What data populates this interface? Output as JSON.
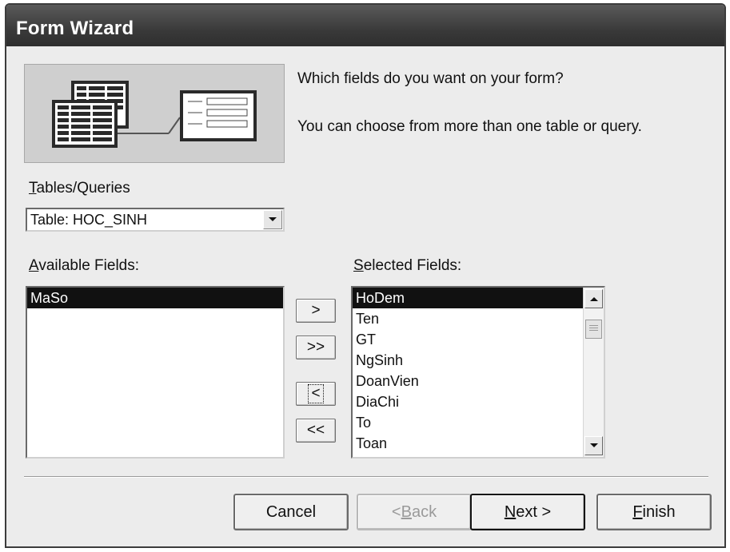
{
  "window": {
    "title": "Form Wizard"
  },
  "prompts": {
    "line1": "Which fields do you want on your form?",
    "line2": "You can choose from more than one table or query."
  },
  "tables_queries": {
    "label_accel": "T",
    "label_rest": "ables/Queries",
    "value": "Table: HOC_SINH",
    "dropdown_icon": "chevron-down-icon"
  },
  "available_fields": {
    "label_accel": "A",
    "label_rest": "vailable Fields:",
    "items": [
      "MaSo"
    ],
    "selected_item": "MaSo"
  },
  "selected_fields": {
    "label_accel": "S",
    "label_rest": "elected Fields:",
    "items": [
      "HoDem",
      "Ten",
      "GT",
      "NgSinh",
      "DoanVien",
      "DiaChi",
      "To",
      "Toan"
    ],
    "selected_item": "HoDem"
  },
  "move_buttons": {
    "add_one": ">",
    "add_all": ">>",
    "remove_one": "<",
    "remove_all": "<<"
  },
  "footer_buttons": {
    "cancel": "Cancel",
    "back_accel": "B",
    "back_prefix": "< ",
    "back_rest": "ack",
    "next_accel": "N",
    "next_rest": "ext >",
    "finish_accel": "F",
    "finish_rest": "inish"
  },
  "colors": {
    "titlebar": "#3a3a3a",
    "selection": "#111111",
    "dialog_bg": "#ececec"
  }
}
